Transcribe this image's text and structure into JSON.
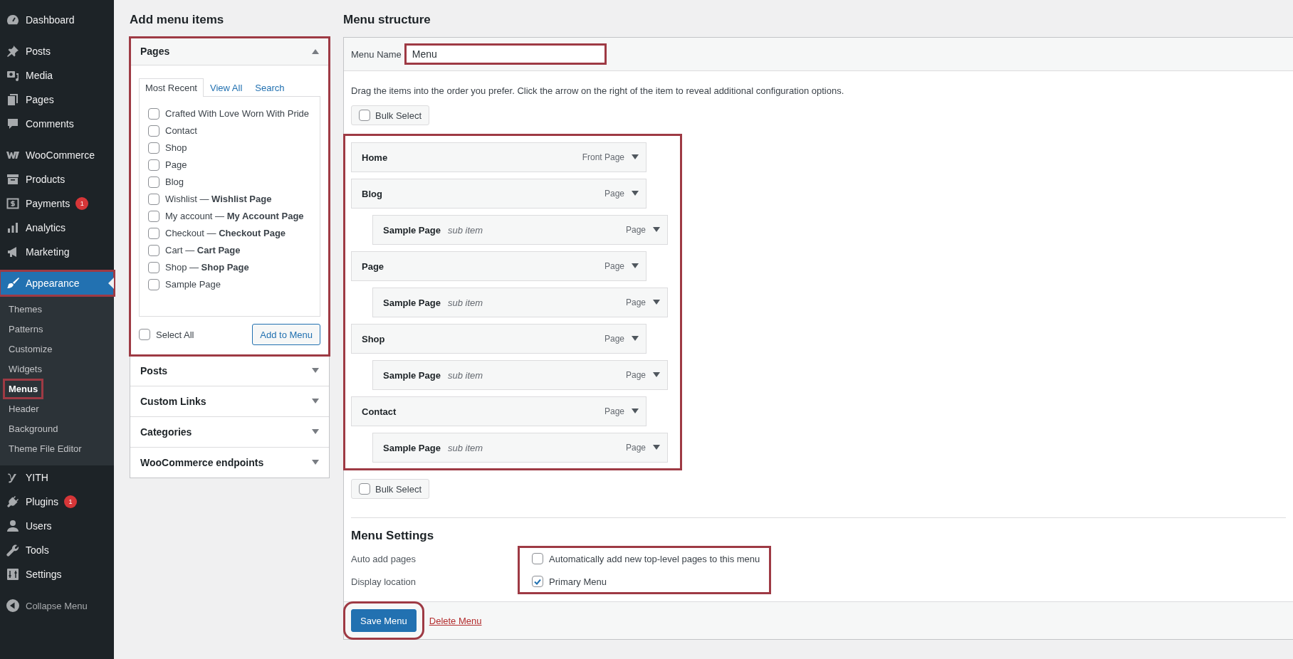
{
  "sidebar": {
    "groups": [
      {
        "items": [
          {
            "label": "Dashboard",
            "selected": false
          }
        ]
      },
      {
        "items": [
          {
            "label": "Posts",
            "selected": false
          },
          {
            "label": "Media",
            "selected": false
          },
          {
            "label": "Pages",
            "selected": false
          },
          {
            "label": "Comments",
            "selected": false
          }
        ]
      },
      {
        "items": [
          {
            "label": "WooCommerce",
            "selected": false
          },
          {
            "label": "Products",
            "selected": false
          },
          {
            "label": "Payments",
            "selected": false,
            "badge": "1"
          },
          {
            "label": "Analytics",
            "selected": false
          },
          {
            "label": "Marketing",
            "selected": false
          }
        ]
      },
      {
        "items": [
          {
            "label": "Appearance",
            "selected": true,
            "highlighted": true,
            "children": [
              {
                "label": "Themes",
                "selected": false
              },
              {
                "label": "Patterns",
                "selected": false
              },
              {
                "label": "Customize",
                "selected": false
              },
              {
                "label": "Widgets",
                "selected": false
              },
              {
                "label": "Menus",
                "selected": true,
                "highlighted": true
              },
              {
                "label": "Header",
                "selected": false
              },
              {
                "label": "Background",
                "selected": false
              },
              {
                "label": "Theme File Editor",
                "selected": false
              }
            ]
          },
          {
            "label": "YITH",
            "selected": false
          },
          {
            "label": "Plugins",
            "selected": false,
            "badge": "1"
          },
          {
            "label": "Users",
            "selected": false
          },
          {
            "label": "Tools",
            "selected": false
          },
          {
            "label": "Settings",
            "selected": false
          }
        ]
      }
    ],
    "collapse": "Collapse Menu"
  },
  "add_menu_items": {
    "title": "Add menu items",
    "sections": [
      {
        "title": "Pages",
        "expanded": true,
        "highlighted": true,
        "tabs": [
          {
            "label": "Most Recent",
            "selected": true
          },
          {
            "label": "View All",
            "selected": false
          },
          {
            "label": "Search",
            "selected": false
          }
        ],
        "pages": [
          {
            "label": "Crafted With Love Worn With Pride",
            "checked": false
          },
          {
            "label": "Contact",
            "checked": false
          },
          {
            "label": "Shop",
            "checked": false
          },
          {
            "label": "Page",
            "checked": false
          },
          {
            "label": "Blog",
            "checked": false
          },
          {
            "label": "Wishlist — **Wishlist Page**",
            "checked": false
          },
          {
            "label": "My account — **My Account Page**",
            "checked": false
          },
          {
            "label": "Checkout — **Checkout Page**",
            "checked": false
          },
          {
            "label": "Cart — **Cart Page**",
            "checked": false
          },
          {
            "label": "Shop — **Shop Page**",
            "checked": false
          },
          {
            "label": "Sample Page",
            "checked": false
          }
        ],
        "select_all": {
          "label": "Select All",
          "checked": false
        },
        "button": "Add to Menu"
      },
      {
        "title": "Posts",
        "expanded": false
      },
      {
        "title": "Custom Links",
        "expanded": false
      },
      {
        "title": "Categories",
        "expanded": false
      },
      {
        "title": "WooCommerce endpoints",
        "expanded": false
      }
    ]
  },
  "menu_structure": {
    "title": "Menu structure",
    "menu_name": {
      "label": "Menu Name",
      "value": "Menu",
      "highlighted": true
    },
    "instructions": "Drag the items into the order you prefer. Click the arrow on the right of the item to reveal additional configuration options.",
    "bulk_select_top": {
      "label": "Bulk Select",
      "checked": false
    },
    "items_highlighted": true,
    "items": [
      {
        "title": "Home",
        "type": "Front Page"
      },
      {
        "title": "Blog",
        "type": "Page",
        "children": [
          {
            "title": "Sample Page",
            "note": "sub item",
            "type": "Page"
          }
        ]
      },
      {
        "title": "Page",
        "type": "Page",
        "children": [
          {
            "title": "Sample Page",
            "note": "sub item",
            "type": "Page"
          }
        ]
      },
      {
        "title": "Shop",
        "type": "Page",
        "children": [
          {
            "title": "Sample Page",
            "note": "sub item",
            "type": "Page"
          }
        ]
      },
      {
        "title": "Contact",
        "type": "Page",
        "children": [
          {
            "title": "Sample Page",
            "note": "sub item",
            "type": "Page"
          }
        ]
      }
    ],
    "bulk_select_bottom": {
      "label": "Bulk Select",
      "checked": false
    },
    "settings": {
      "title": "Menu Settings",
      "highlighted": true,
      "rows": [
        {
          "label": "Auto add pages",
          "option": {
            "label": "Automatically add new top-level pages to this menu",
            "checked": false
          }
        },
        {
          "label": "Display location",
          "option": {
            "label": "Primary Menu",
            "checked": true
          }
        }
      ]
    },
    "save_button": {
      "label": "Save Menu",
      "highlighted": true
    },
    "delete_link": "Delete Menu"
  }
}
